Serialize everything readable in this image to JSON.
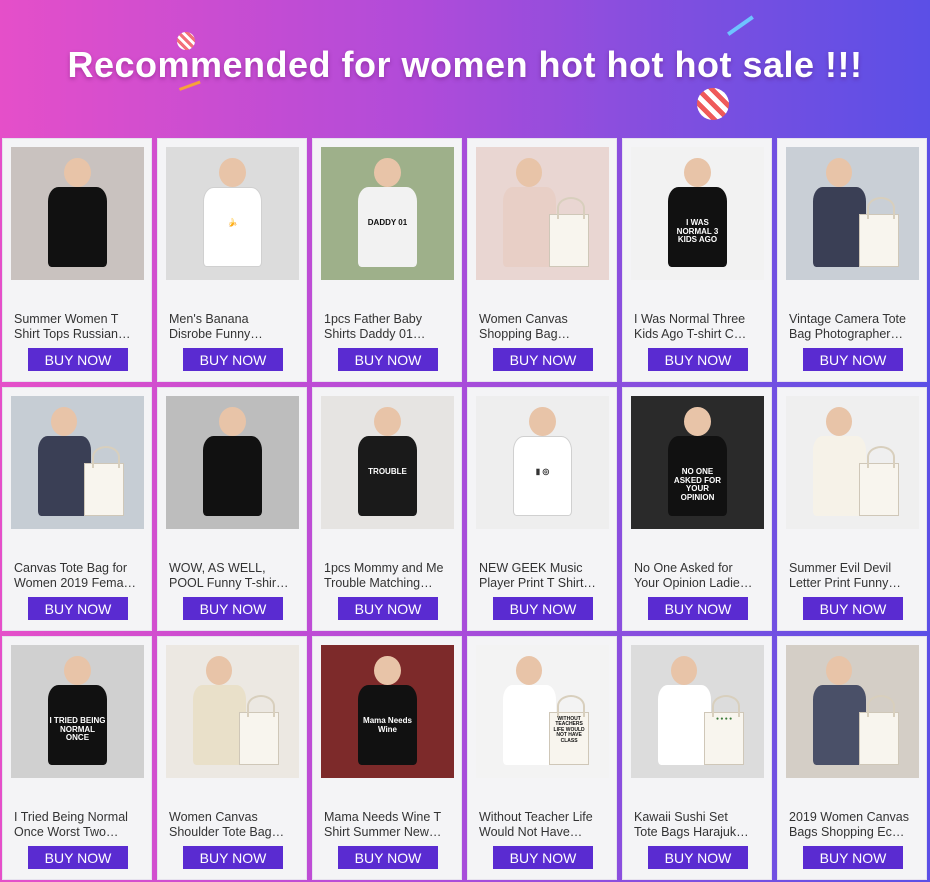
{
  "banner": {
    "title": "Recommended for women hot hot hot sale !!!"
  },
  "buy_label": "BUY NOW",
  "products": [
    {
      "l1": "Summer Women T",
      "l2": "Shirt Tops Russian…",
      "img": "shirt-women",
      "bg": "#c9c2bf",
      "shirt": "#111111",
      "txt": "",
      "txtc": "#fff"
    },
    {
      "l1": "Men's Banana",
      "l2": "Disrobe Funny…",
      "img": "shirt-man",
      "bg": "#dcdcdc",
      "shirt": "#ffffff",
      "txt": "🍌",
      "txtc": "#e2c000"
    },
    {
      "l1": "1pcs Father Baby",
      "l2": "Shirts Daddy 01…",
      "img": "shirt-daddy",
      "bg": "#9eb08a",
      "shirt": "#f2f2f2",
      "txt": "DADDY 01",
      "txtc": "#111"
    },
    {
      "l1": "Women Canvas",
      "l2": "Shopping Bag…",
      "img": "bag-woman",
      "bg": "#e9d6d2",
      "shirt": "#e8cfc6",
      "txt": "",
      "txtc": "#333"
    },
    {
      "l1": "I Was Normal Three",
      "l2": "Kids Ago T-shirt C…",
      "img": "shirt-flat",
      "bg": "#f2f2f2",
      "shirt": "#111111",
      "txt": "I WAS NORMAL 3 KIDS AGO",
      "txtc": "#fff"
    },
    {
      "l1": "Vintage Camera Tote",
      "l2": "Bag Photographer…",
      "img": "bag-camera",
      "bg": "#c9cfd6",
      "shirt": "#3a3f55",
      "txt": "",
      "txtc": "#333"
    },
    {
      "l1": "Canvas Tote Bag for",
      "l2": "Women 2019 Fema…",
      "img": "bag-beach",
      "bg": "#c6cdd4",
      "shirt": "#3a3f55",
      "txt": "",
      "txtc": "#333"
    },
    {
      "l1": "WOW, AS WELL,",
      "l2": "POOL Funny T-shir…",
      "img": "shirt-women2",
      "bg": "#bdbdbd",
      "shirt": "#111111",
      "txt": "",
      "txtc": "#fff"
    },
    {
      "l1": "1pcs Mommy and Me",
      "l2": "Trouble Matching…",
      "img": "shirt-mommy",
      "bg": "#e6e4e2",
      "shirt": "#1a1a1a",
      "txt": "TROUBLE",
      "txtc": "#fff"
    },
    {
      "l1": "NEW GEEK Music",
      "l2": "Player Print T Shirt…",
      "img": "shirt-geek",
      "bg": "#eeeeee",
      "shirt": "#ffffff",
      "txt": "▮ ◎",
      "txtc": "#333"
    },
    {
      "l1": "No One Asked for",
      "l2": "Your Opinion Ladie…",
      "img": "shirt-opinion",
      "bg": "#2a2a2a",
      "shirt": "#111111",
      "txt": "NO ONE ASKED FOR YOUR OPINION",
      "txtc": "#fff"
    },
    {
      "l1": "Summer Evil Devil",
      "l2": "Letter Print Funny…",
      "img": "bag-devil",
      "bg": "#efefef",
      "shirt": "#f6f2e8",
      "txt": "",
      "txtc": "#c33"
    },
    {
      "l1": "I Tried Being Normal",
      "l2": "Once Worst Two…",
      "img": "shirt-tried",
      "bg": "#d0d0d0",
      "shirt": "#111111",
      "txt": "I TRIED BEING NORMAL ONCE",
      "txtc": "#fff"
    },
    {
      "l1": "Women Canvas",
      "l2": "Shoulder Tote Bag…",
      "img": "bag-hat",
      "bg": "#ece8e2",
      "shirt": "#e9e0c9",
      "txt": "",
      "txtc": "#333"
    },
    {
      "l1": "Mama Needs Wine T",
      "l2": "Shirt Summer New…",
      "img": "shirt-wine",
      "bg": "#7d2a2a",
      "shirt": "#111111",
      "txt": "Mama Needs Wine",
      "txtc": "#fff"
    },
    {
      "l1": "Without Teacher Life",
      "l2": "Would Not Have…",
      "img": "bag-teacher",
      "bg": "#f3f3f3",
      "shirt": "#ffffff",
      "txt": "WITHOUT TEACHERS LIFE WOULD NOT HAVE CLASS",
      "txtc": "#111"
    },
    {
      "l1": "Kawaii Sushi Set",
      "l2": "Tote Bags Harajuk…",
      "img": "bag-sushi",
      "bg": "#dcdcdc",
      "shirt": "#ffffff",
      "txt": "● ● ● ●",
      "txtc": "#3a7a3a"
    },
    {
      "l1": "2019 Women Canvas",
      "l2": "Bags Shopping Ec…",
      "img": "bag-feminism",
      "bg": "#d4cec6",
      "shirt": "#4a5068",
      "txt": "",
      "txtc": "#333"
    }
  ]
}
